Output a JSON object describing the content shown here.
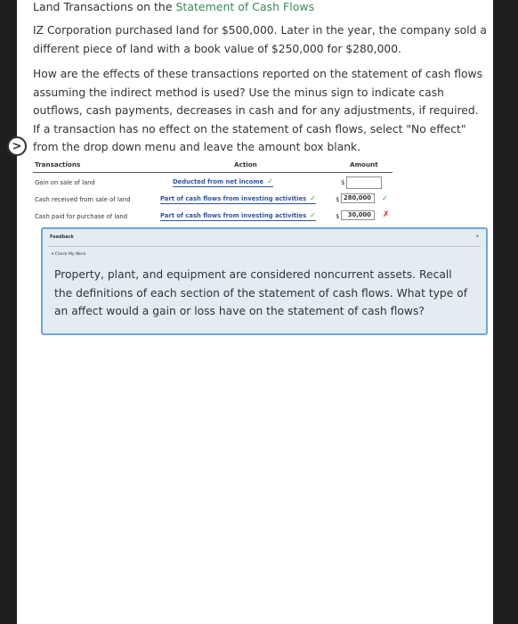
{
  "header": {
    "title_prefix": "Land Transactions on the ",
    "title_link": "Statement of Cash Flows"
  },
  "question": {
    "p1": "IZ Corporation purchased land for $500,000. Later in the year, the company sold a different piece of land with a book value of $250,000 for $280,000.",
    "p2": "How are the effects of these transactions reported on the statement of cash flows assuming the indirect method is used? Use the minus sign to indicate cash outflows, cash payments, decreases in cash and for any adjustments, if required. If a transaction has no effect on the statement of cash flows, select \"No effect\" from the drop down menu and leave the amount box blank."
  },
  "nav": {
    "icon": "chevron-right-icon",
    "glyph": ">"
  },
  "table": {
    "headers": {
      "transactions": "Transactions",
      "action": "Action",
      "amount": "Amount"
    },
    "currency": "$",
    "rows": [
      {
        "label": "Gain on sale of land",
        "action": "Deducted from net income",
        "action_mark": "✓",
        "amount": "",
        "amount_mark": ""
      },
      {
        "label": "Cash received from sale of land",
        "action": "Part of cash flows from investing activities",
        "action_mark": "✓",
        "amount": "280,000",
        "amount_mark": "✓"
      },
      {
        "label": "Cash paid for purchase of land",
        "action": "Part of cash flows from investing activities",
        "action_mark": "✓",
        "amount": "30,000",
        "amount_mark": "✗"
      }
    ]
  },
  "feedback": {
    "heading": "Feedback",
    "collapse_icon": "*",
    "check_label": "▾ Check My Work",
    "text": "Property, plant, and equipment are considered noncurrent assets. Recall the definitions of each section of the statement of cash flows. What type of an affect would a gain or loss have on the statement of cash flows?"
  },
  "colors": {
    "link": "#3a8a5a",
    "action": "#2f55a4",
    "correct": "#2e9e3e",
    "incorrect": "#d22222",
    "feedback_border": "#6fa6d8",
    "feedback_bg": "#e3ecf3"
  }
}
